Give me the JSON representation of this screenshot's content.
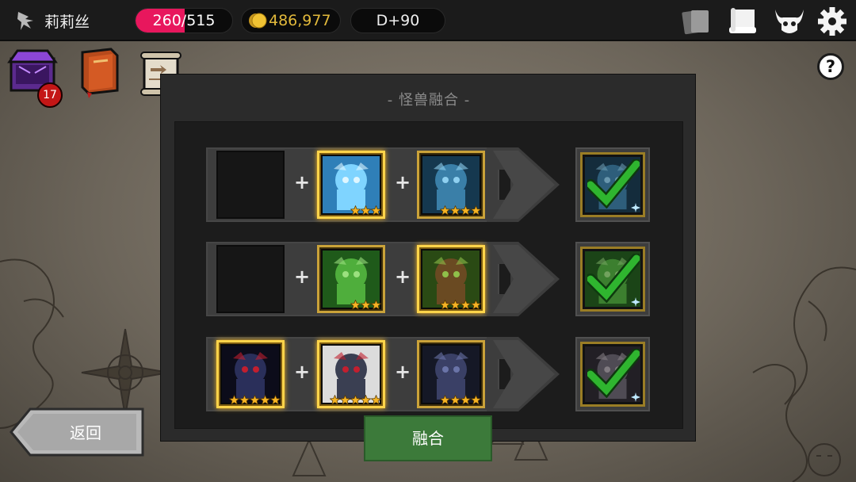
{
  "player": {
    "name": "莉莉丝",
    "icon": "dragon-icon"
  },
  "stats": {
    "hp_current": "260",
    "hp_separator": "/",
    "hp_max": "515",
    "hp_ratio": 0.505,
    "gold": "486,977",
    "day": "D+90"
  },
  "top_icons": [
    "cards-icon",
    "scroll-icon",
    "demon-horns-icon",
    "gear-icon"
  ],
  "left_items": [
    {
      "name": "purple-chest-icon",
      "badge": "17"
    },
    {
      "name": "spellbook-icon"
    },
    {
      "name": "map-scroll-icon"
    }
  ],
  "help": "?",
  "panel": {
    "title": "- 怪兽融合 -",
    "rows": [
      {
        "slots": [
          {
            "empty": true
          },
          {
            "art": "blue-girl-monster",
            "stars": 3,
            "highlight": true
          },
          {
            "art": "blue-golem-monster",
            "stars": 4,
            "highlight": false
          }
        ],
        "result": {
          "art": "blue-monster-result",
          "checked": true,
          "gem": "snowflake-icon"
        }
      },
      {
        "slots": [
          {
            "empty": true
          },
          {
            "art": "green-dryad-monster",
            "stars": 3,
            "highlight": false
          },
          {
            "art": "treant-monster",
            "stars": 4,
            "highlight": true
          }
        ],
        "result": {
          "art": "green-dryad-result",
          "checked": true,
          "gem": "snowflake-icon"
        }
      },
      {
        "slots": [
          {
            "art": "hooded-reaper-monster",
            "stars": 5,
            "highlight": true
          },
          {
            "art": "skeleton-knight-monster",
            "stars": 5,
            "highlight": true
          },
          {
            "art": "dark-witch-monster",
            "stars": 4,
            "highlight": false
          }
        ],
        "result": {
          "art": "reaper-result",
          "checked": true,
          "gem": "snowflake-icon"
        }
      }
    ],
    "plus": "+"
  },
  "buttons": {
    "fuse": "融合",
    "back": "返回"
  },
  "colors": {
    "hp": "#e8175d",
    "gold_text": "#e2b93b",
    "fuse_button": "#3c7a3a",
    "check": "#2fb52f",
    "card_border": "#caa239"
  }
}
